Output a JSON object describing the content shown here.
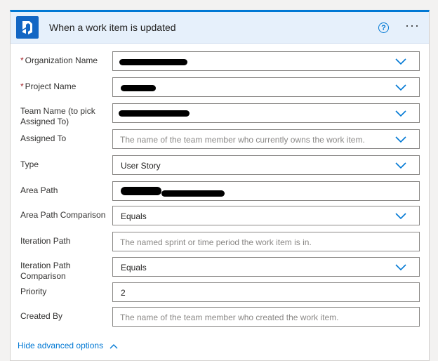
{
  "header": {
    "title": "When a work item is updated",
    "help_glyph": "?",
    "more_glyph": "···",
    "logo_icon": "azure-devops-icon",
    "accent_color": "#0078d4"
  },
  "fields": {
    "organization": {
      "required_mark": "*",
      "label": "Organization Name",
      "value": ""
    },
    "project": {
      "required_mark": "*",
      "label": "Project Name",
      "value": ""
    },
    "team": {
      "label": "Team Name (to pick Assigned To)",
      "value": ""
    },
    "assigned_to": {
      "label": "Assigned To",
      "placeholder": "The name of the team member who currently owns the work item."
    },
    "type": {
      "label": "Type",
      "value": "User Story"
    },
    "area_path": {
      "label": "Area Path",
      "value": ""
    },
    "area_path_comparison": {
      "label": "Area Path Comparison",
      "value": "Equals"
    },
    "iteration_path": {
      "label": "Iteration Path",
      "placeholder": "The named sprint or time period the work item is in."
    },
    "iteration_path_comparison": {
      "label": "Iteration Path Comparison",
      "value": "Equals"
    },
    "priority": {
      "label": "Priority",
      "value": "2"
    },
    "created_by": {
      "label": "Created By",
      "placeholder": "The name of the team member who created the work item."
    }
  },
  "advanced": {
    "label": "Hide advanced options"
  }
}
